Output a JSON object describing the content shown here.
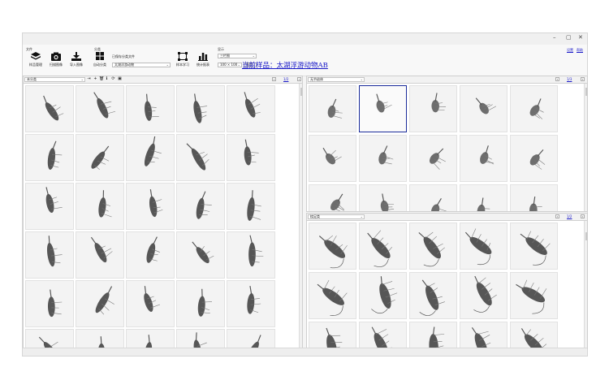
{
  "window_controls": {
    "minimize": "–",
    "maximize": "▢",
    "close": "✕"
  },
  "header_links": {
    "settings": "设置",
    "help": "帮助"
  },
  "ribbon": {
    "file_group": "文件",
    "classify_group": "分类",
    "display_group": "显示",
    "buttons": {
      "sample_manage": "样品管理",
      "scan_image": "扫描图像",
      "import_image": "导入图像",
      "auto_classify": "自动分类",
      "manual_learn": "样本学习",
      "stats_report": "统计报表"
    },
    "classifier_label": "已保存分类文件",
    "classifier_value": "太湖浮游动物",
    "view_mode": "三栏图",
    "size_value": "100 × 100",
    "sort_value": "面积"
  },
  "sample_title": "当前样品：太湖浮游动物AB",
  "left_panel": {
    "combo": "未分类",
    "pager": "1/2"
  },
  "right_top_panel": {
    "combo": "无节幼体",
    "pager": "1/3"
  },
  "right_bottom_panel": {
    "combo": "桡足类",
    "pager": "1/2"
  },
  "colors": {
    "selected_border": "#1a2b9a",
    "link": "#1a1ac8"
  }
}
